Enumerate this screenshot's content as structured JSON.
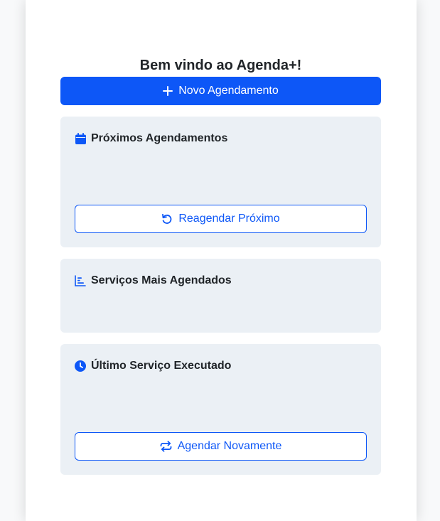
{
  "header": {
    "title": "Bem vindo ao Agenda+!"
  },
  "actions": {
    "new_appointment_label": "Novo Agendamento"
  },
  "cards": {
    "upcoming": {
      "title": "Próximos Agendamentos",
      "icon": "calendar-icon",
      "button_label": "Reagendar Próximo",
      "button_icon": "rotate-ccw-icon"
    },
    "top_services": {
      "title": "Serviços Mais Agendados",
      "icon": "bar-chart-icon"
    },
    "last_service": {
      "title": "Último Serviço Executado",
      "icon": "clock-icon",
      "button_label": "Agendar Novamente",
      "button_icon": "repeat-icon"
    }
  },
  "colors": {
    "primary": "#0d57f7",
    "card_bg": "#ebf0f5",
    "text": "#212529"
  }
}
